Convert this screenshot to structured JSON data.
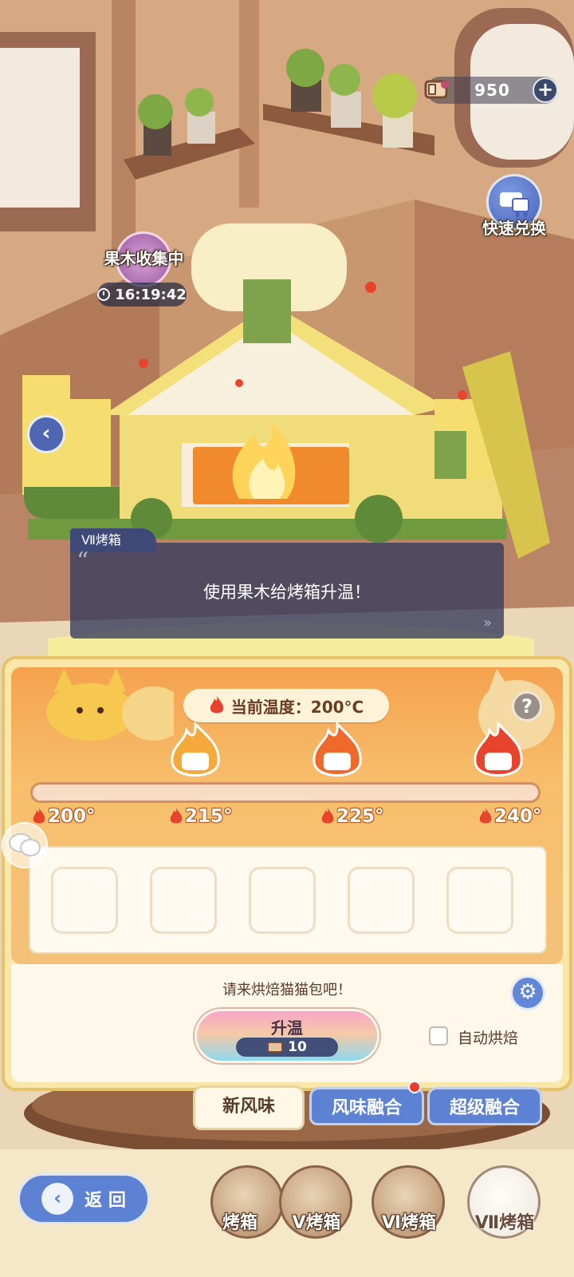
{
  "header": {
    "currency_amount": "950",
    "plus_label": "+",
    "quick_exchange_label": "快速兑换"
  },
  "wood_status": {
    "label": "果木收集中",
    "timer": "16:19:42"
  },
  "dialog": {
    "speaker": "Ⅶ烤箱",
    "text": "使用果木给烤箱升温！"
  },
  "temperature": {
    "current_label": "当前温度：200°C",
    "ticks": [
      "200°",
      "215°",
      "225°",
      "240°"
    ],
    "progress_fraction": 0.0
  },
  "panel": {
    "prompt": "请来烘焙猫猫包吧！",
    "upgrade_label": "升温",
    "upgrade_cost": "10",
    "auto_bake_label": "自动烘焙",
    "slot_count": 5
  },
  "tabs": [
    {
      "label": "新风味",
      "active": true
    },
    {
      "label": "风味融合",
      "active": false
    },
    {
      "label": "超级融合",
      "active": false
    }
  ],
  "bottom_nav": {
    "back_label": "返 回",
    "ovens": [
      "烤箱",
      "Ⅴ烤箱",
      "Ⅵ烤箱",
      "Ⅶ烤箱"
    ],
    "active_oven_index": 3
  },
  "colors": {
    "accent_blue": "#5d82d4",
    "panel_orange": "#f5a24e",
    "flame_red": "#e8432c"
  }
}
